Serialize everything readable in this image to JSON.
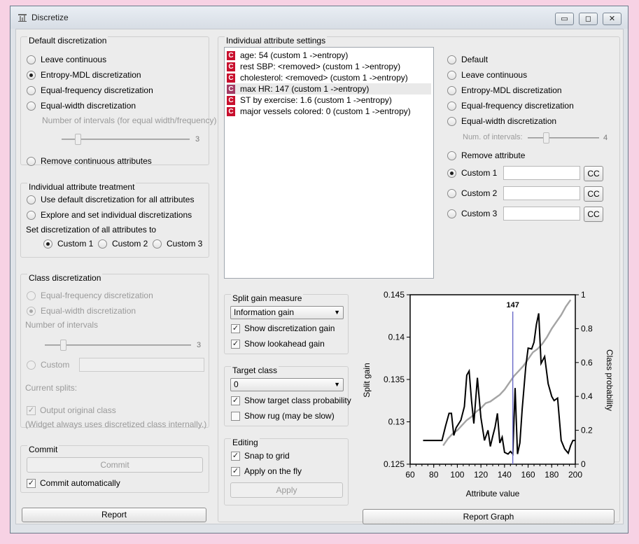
{
  "window": {
    "title": "Discretize",
    "controls": [
      "▭",
      "◻",
      "✕"
    ]
  },
  "default_disc": {
    "title": "Default discretization",
    "options": [
      "Leave continuous",
      "Entropy-MDL discretization",
      "Equal-frequency discretization",
      "Equal-width discretization"
    ],
    "selected": 1,
    "intervals_label": "Number of intervals (for equal width/frequency)",
    "intervals_value": "3",
    "remove_label": "Remove continuous attributes"
  },
  "treatment": {
    "title": "Individual attribute treatment",
    "options": [
      "Use default discretization for all attributes",
      "Explore and set individual discretizations"
    ],
    "set_label": "Set discretization of all attributes to",
    "custom": [
      "Custom 1",
      "Custom 2",
      "Custom 3"
    ]
  },
  "class_disc": {
    "title": "Class discretization",
    "options": [
      "Equal-frequency discretization",
      "Equal-width discretization"
    ],
    "intervals_label": "Number of intervals",
    "intervals_value": "3",
    "custom_label": "Custom",
    "splits_label": "Current splits:",
    "output_label": "Output original class",
    "note": "(Widget always uses discretized class internally.)"
  },
  "commit": {
    "title": "Commit",
    "button": "Commit",
    "auto_label": "Commit automatically"
  },
  "report_button": "Report",
  "attr_settings": {
    "title": "Individual attribute settings",
    "items": [
      {
        "badge": "C",
        "text": "age: 54 (custom 1 ->entropy)"
      },
      {
        "badge": "C",
        "text": "rest SBP: <removed> (custom 1 ->entropy)"
      },
      {
        "badge": "C",
        "text": "cholesterol: <removed> (custom 1 ->entropy)"
      },
      {
        "badge": "C",
        "text": "max HR: 147 (custom 1 ->entropy)"
      },
      {
        "badge": "C",
        "text": "ST by exercise: 1.6 (custom 1 ->entropy)"
      },
      {
        "badge": "C",
        "text": "major vessels colored: 0 (custom 1 ->entropy)"
      }
    ],
    "selected_index": 3
  },
  "attr_options": {
    "options": [
      "Default",
      "Leave continuous",
      "Entropy-MDL discretization",
      "Equal-frequency discretization",
      "Equal-width discretization"
    ],
    "intervals_label": "Num. of intervals:",
    "intervals_value": "4",
    "remove_label": "Remove attribute",
    "custom": [
      "Custom 1",
      "Custom 2",
      "Custom 3"
    ],
    "cc_label": "CC"
  },
  "split_gain": {
    "title": "Split gain measure",
    "measure": "Information gain",
    "show_disc": "Show discretization gain",
    "show_lookahead": "Show lookahead gain"
  },
  "target": {
    "title": "Target class",
    "value": "0",
    "show_prob": "Show target class probability",
    "show_rug": "Show rug (may be slow)"
  },
  "editing": {
    "title": "Editing",
    "snap": "Snap to grid",
    "apply_fly": "Apply on the fly",
    "apply": "Apply"
  },
  "report_graph_button": "Report Graph",
  "chart_data": {
    "type": "line",
    "xlabel": "Attribute value",
    "ylabel": "Split gain",
    "y2label": "Class probability",
    "xlim": [
      60,
      200
    ],
    "ylim": [
      0.125,
      0.145
    ],
    "y2lim": [
      0,
      1
    ],
    "xticks": [
      "60",
      "80",
      "100",
      "120",
      "140",
      "160",
      "180",
      "200"
    ],
    "yticks": [
      "0.125",
      "0.13",
      "0.135",
      "0.14",
      "0.145"
    ],
    "y2ticks": [
      "0",
      "0.2",
      "0.4",
      "0.6",
      "0.8",
      "1"
    ],
    "cut_label": "147",
    "cut_value": 147,
    "gain": {
      "x": [
        71,
        74,
        78,
        82,
        87,
        90,
        93,
        95,
        97,
        99,
        103,
        106,
        108,
        110,
        112,
        114,
        117,
        120,
        123,
        126,
        128,
        130,
        132,
        134,
        136,
        138,
        140,
        143,
        145,
        147,
        149,
        151,
        153,
        155,
        158,
        160,
        163,
        165,
        167,
        169,
        171,
        174,
        177,
        180,
        182,
        185,
        188,
        191,
        194,
        196,
        198,
        200
      ],
      "y": [
        0.1278,
        0.1278,
        0.1278,
        0.1278,
        0.1278,
        0.1295,
        0.131,
        0.131,
        0.1284,
        0.1293,
        0.1302,
        0.1318,
        0.1355,
        0.136,
        0.1325,
        0.1298,
        0.1352,
        0.1305,
        0.1278,
        0.129,
        0.1271,
        0.1283,
        0.1294,
        0.131,
        0.1275,
        0.1282,
        0.1264,
        0.1262,
        0.1265,
        0.1262,
        0.134,
        0.1262,
        0.1275,
        0.1315,
        0.1365,
        0.1387,
        0.1386,
        0.1394,
        0.1415,
        0.1428,
        0.1369,
        0.1377,
        0.1345,
        0.133,
        0.1325,
        0.1328,
        0.1278,
        0.1268,
        0.1263,
        0.1272,
        0.1278,
        0.1278
      ]
    },
    "probability": {
      "x": [
        88,
        92,
        96,
        100,
        104,
        108,
        112,
        116,
        120,
        124,
        128,
        132,
        136,
        140,
        144,
        148,
        152,
        156,
        160,
        164,
        168,
        172,
        176,
        180,
        184,
        188,
        192,
        196
      ],
      "y": [
        0.11,
        0.15,
        0.18,
        0.2,
        0.23,
        0.26,
        0.28,
        0.31,
        0.33,
        0.36,
        0.37,
        0.39,
        0.41,
        0.44,
        0.48,
        0.52,
        0.55,
        0.58,
        0.62,
        0.66,
        0.68,
        0.71,
        0.75,
        0.8,
        0.84,
        0.88,
        0.93,
        0.97
      ]
    }
  }
}
